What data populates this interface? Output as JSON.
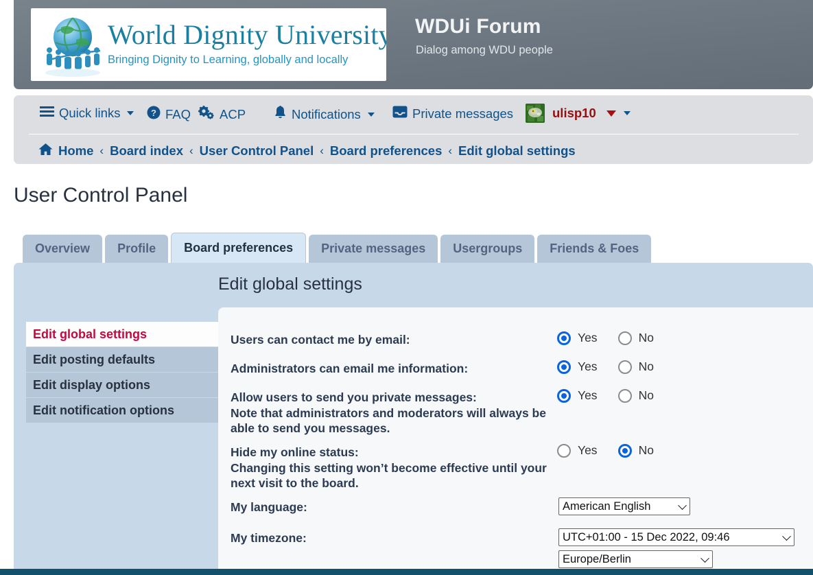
{
  "header": {
    "logo_title": "World Dignity University",
    "logo_subtitle": "Bringing Dignity to Learning, globally and locally",
    "site_title": "WDUi Forum",
    "site_description": "Dialog among WDU people",
    "logo_icon": "globe-people-logo"
  },
  "nav": {
    "items": [
      {
        "label": "Quick links",
        "icon": "hamburger-icon",
        "has_caret": true
      },
      {
        "label": "FAQ",
        "icon": "question-circle-icon",
        "has_caret": false
      },
      {
        "label": "ACP",
        "icon": "double-gear-icon",
        "has_caret": false
      },
      {
        "label": "Notifications",
        "icon": "bell-icon",
        "has_caret": true
      },
      {
        "label": "Private messages",
        "icon": "inbox-icon",
        "has_caret": false
      }
    ],
    "user": {
      "name": "ulisp10",
      "avatar_icon": "user-avatar-thumbnail",
      "caret_color": "#961010"
    }
  },
  "breadcrumb": {
    "home_icon": "home-icon",
    "separator": "‹",
    "items": [
      "Home",
      "Board index",
      "User Control Panel",
      "Board preferences",
      "Edit global settings"
    ]
  },
  "page": {
    "title": "User Control Panel"
  },
  "tabs": [
    {
      "label": "Overview",
      "active": false
    },
    {
      "label": "Profile",
      "active": false
    },
    {
      "label": "Board preferences",
      "active": true
    },
    {
      "label": "Private messages",
      "active": false
    },
    {
      "label": "Usergroups",
      "active": false
    },
    {
      "label": "Friends & Foes",
      "active": false
    }
  ],
  "panel": {
    "heading": "Edit global settings"
  },
  "sidebar": {
    "items": [
      {
        "label": "Edit global settings",
        "active": true
      },
      {
        "label": "Edit posting defaults",
        "active": false
      },
      {
        "label": "Edit display options",
        "active": false
      },
      {
        "label": "Edit notification options",
        "active": false
      }
    ]
  },
  "form": {
    "yes_label": "Yes",
    "no_label": "No",
    "rows": [
      {
        "label": "Users can contact me by email:",
        "note": "",
        "value": "Yes"
      },
      {
        "label": "Administrators can email me information:",
        "note": "",
        "value": "Yes"
      },
      {
        "label": "Allow users to send you private messages:",
        "note": "Note that administrators and moderators will always be able to send you messages.",
        "value": "Yes"
      },
      {
        "label": "Hide my online status:",
        "note": "Changing this setting won’t become effective until your next visit to the board.",
        "value": "No"
      }
    ],
    "language": {
      "label": "My language:",
      "value": "American English"
    },
    "timezone": {
      "label": "My timezone:",
      "value": "UTC+01:00 - 15 Dec 2022, 09:46",
      "region_value": "Europe/Berlin"
    }
  },
  "colors": {
    "link": "#105289",
    "accent_red": "#c3093f",
    "username_red": "#961010",
    "panel_blue": "#c7d9e9",
    "tab_blue": "#b5c6d8",
    "radio_blue": "#0a64e0",
    "footer_teal": "#12506b"
  }
}
